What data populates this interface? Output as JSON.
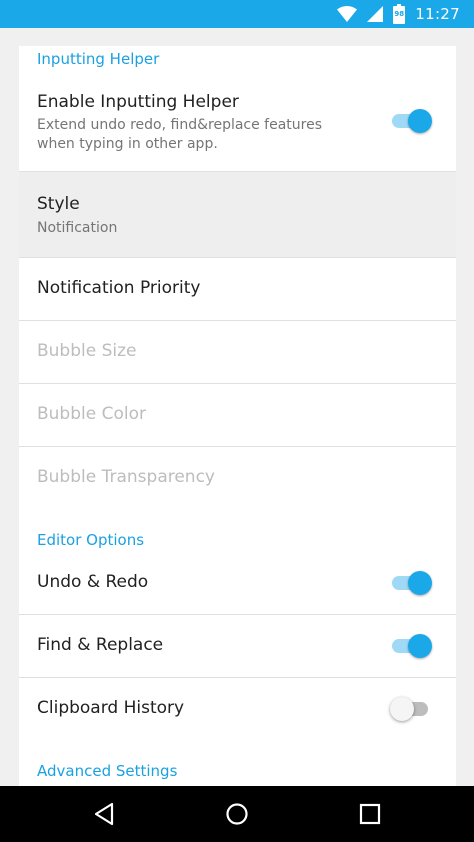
{
  "status_bar": {
    "time": "11:27",
    "battery_level": "98",
    "icons": [
      "wifi-icon",
      "signal-icon",
      "battery-icon"
    ]
  },
  "sections": {
    "inputting_helper": "Inputting Helper",
    "editor_options": "Editor Options",
    "advanced_settings": "Advanced Settings"
  },
  "settings": {
    "enable_helper": {
      "title": "Enable Inputting Helper",
      "summary_line1": "Extend undo redo, find&replace features",
      "summary_line2": "when typing in other app.",
      "enabled": true
    },
    "style": {
      "title": "Style",
      "summary": "Notification"
    },
    "notification_priority": {
      "title": "Notification Priority"
    },
    "bubble_size": {
      "title": "Bubble Size"
    },
    "bubble_color": {
      "title": "Bubble Color"
    },
    "bubble_transparency": {
      "title": "Bubble Transparency"
    },
    "undo_redo": {
      "title": "Undo & Redo",
      "enabled": true
    },
    "find_replace": {
      "title": "Find & Replace",
      "enabled": true
    },
    "clipboard_history": {
      "title": "Clipboard History",
      "enabled": false
    }
  },
  "colors": {
    "accent": "#1ba8e8",
    "status_bar": "#1ba8e8",
    "background": "#f0f0f0",
    "card": "#ffffff",
    "disabled_text": "#bdbdbd"
  },
  "nav": {
    "buttons": [
      "back-icon",
      "home-icon",
      "recents-icon"
    ]
  }
}
